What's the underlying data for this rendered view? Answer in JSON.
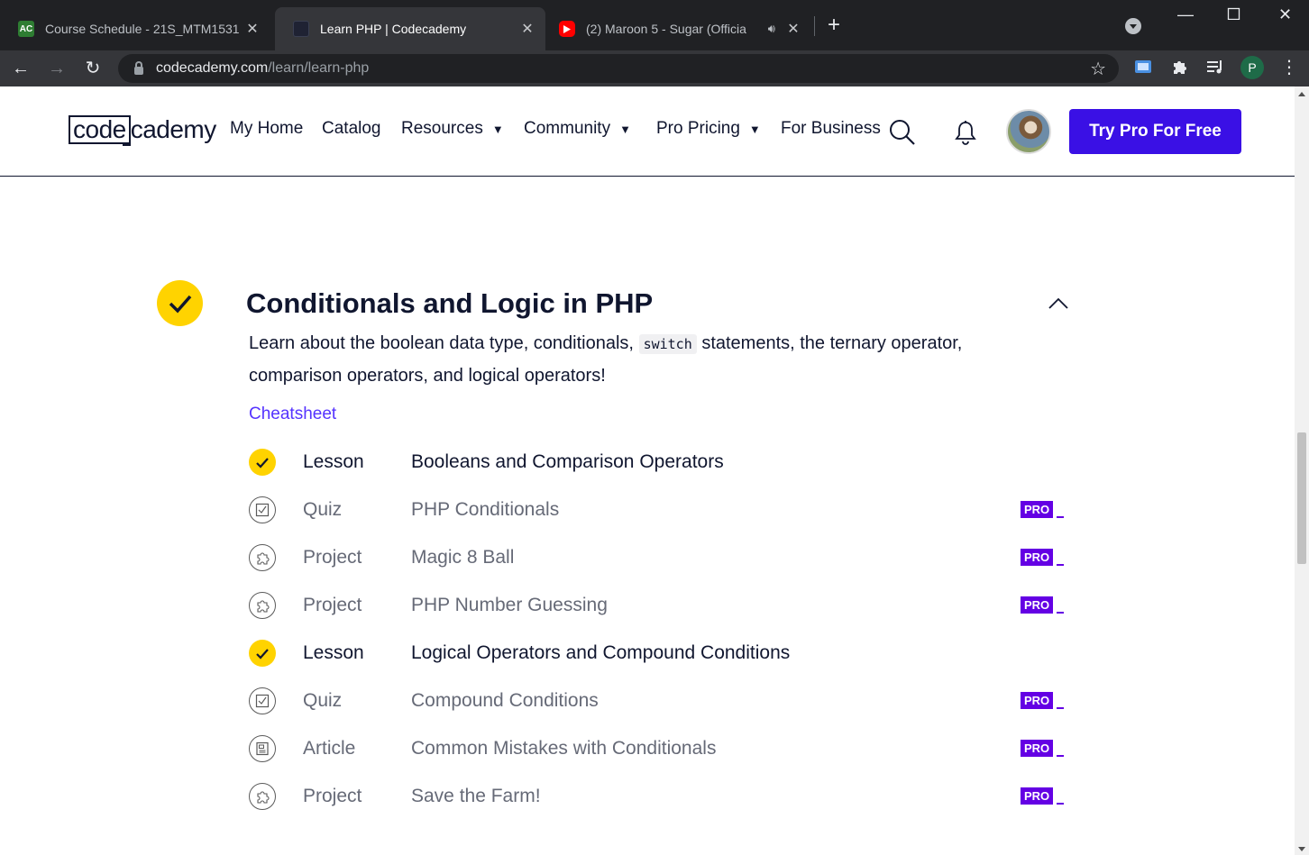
{
  "browser": {
    "tabs": [
      {
        "title": "Course Schedule - 21S_MTM1531",
        "favicon": "ac-logo-icon",
        "active": false
      },
      {
        "title": "Learn PHP | Codecademy",
        "favicon": "codecademy-icon",
        "active": true
      },
      {
        "title": "(2) Maroon 5 - Sugar (Officia",
        "favicon": "youtube-icon",
        "active": false,
        "audio": true
      }
    ],
    "url_host": "codecademy.com",
    "url_path": "/learn/learn-php",
    "profile_initial": "P"
  },
  "header": {
    "logo_code": "code",
    "logo_rest": "cademy",
    "nav": [
      {
        "label": "My Home",
        "dropdown": false
      },
      {
        "label": "Catalog",
        "dropdown": false
      },
      {
        "label": "Resources",
        "dropdown": true
      },
      {
        "label": "Community",
        "dropdown": true
      },
      {
        "label": "Pro Pricing",
        "dropdown": true
      },
      {
        "label": "For Business",
        "dropdown": false
      }
    ],
    "cta": "Try Pro For Free"
  },
  "module": {
    "title": "Conditionals and Logic in PHP",
    "desc_before": "Learn about the boolean data type, conditionals,",
    "desc_code": "switch",
    "desc_after": "statements, the ternary operator, comparison operators, and logical operators!",
    "cheatsheet": "Cheatsheet",
    "pro_label": "PRO",
    "items": [
      {
        "kind": "Lesson",
        "name": "Booleans and Comparison Operators",
        "status": "done",
        "icon": "check-icon",
        "pro": false
      },
      {
        "kind": "Quiz",
        "name": "PHP Conditionals",
        "status": "todo",
        "icon": "quiz-icon",
        "pro": true
      },
      {
        "kind": "Project",
        "name": "Magic 8 Ball",
        "status": "todo",
        "icon": "project-icon",
        "pro": true
      },
      {
        "kind": "Project",
        "name": "PHP Number Guessing",
        "status": "todo",
        "icon": "project-icon",
        "pro": true
      },
      {
        "kind": "Lesson",
        "name": "Logical Operators and Compound Conditions",
        "status": "done",
        "icon": "check-icon",
        "pro": false
      },
      {
        "kind": "Quiz",
        "name": "Compound Conditions",
        "status": "todo",
        "icon": "quiz-icon",
        "pro": true
      },
      {
        "kind": "Article",
        "name": "Common Mistakes with Conditionals",
        "status": "todo",
        "icon": "article-icon",
        "pro": true
      },
      {
        "kind": "Project",
        "name": "Save the Farm!",
        "status": "todo",
        "icon": "project-icon",
        "pro": true
      }
    ]
  }
}
